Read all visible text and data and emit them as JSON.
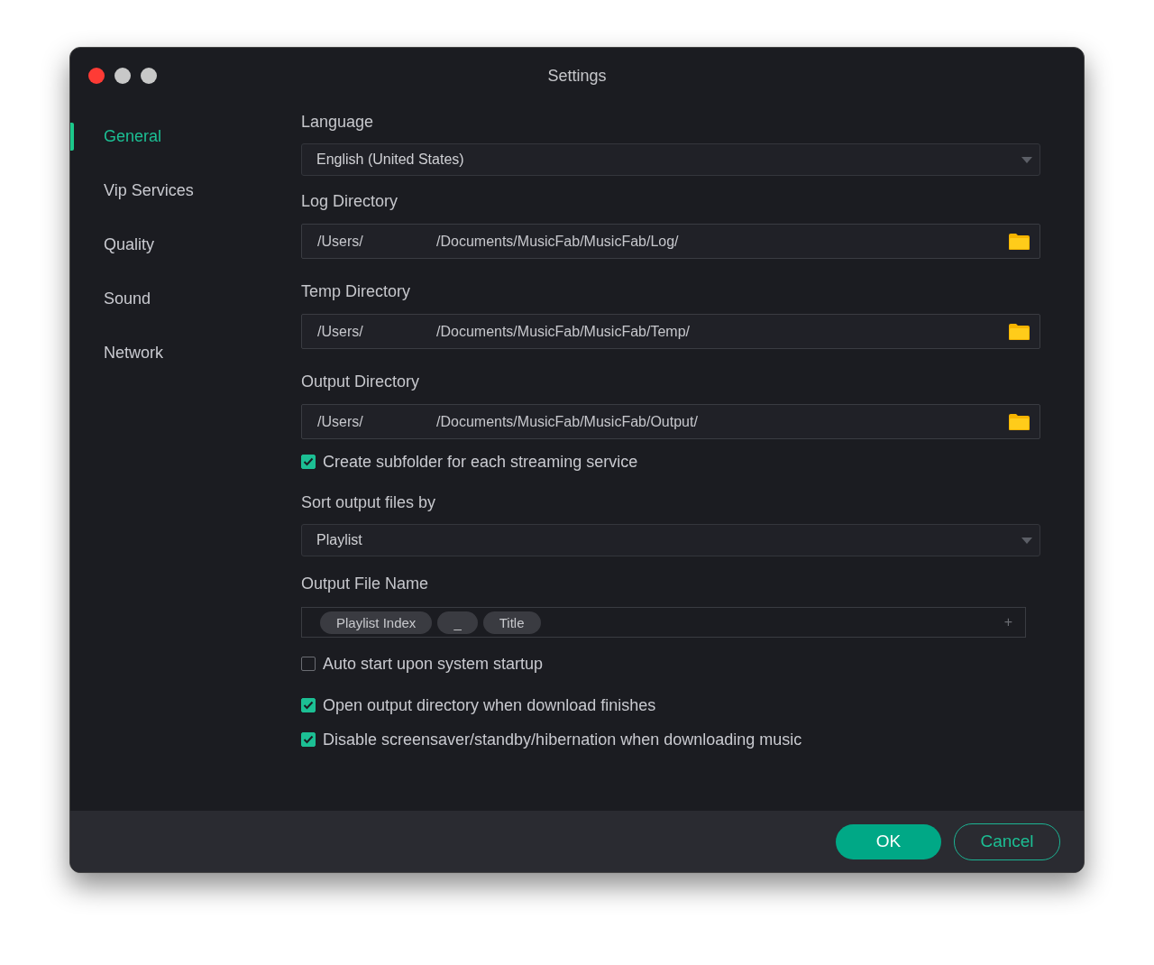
{
  "window": {
    "title": "Settings"
  },
  "sidebar": {
    "items": [
      {
        "label": "General",
        "selected": true
      },
      {
        "label": "Vip Services",
        "selected": false
      },
      {
        "label": "Quality",
        "selected": false
      },
      {
        "label": "Sound",
        "selected": false
      },
      {
        "label": "Network",
        "selected": false
      }
    ]
  },
  "settings": [
    {
      "kind": "select",
      "label": "Language",
      "value": "English (United States)"
    },
    {
      "kind": "directory",
      "label": "Log Directory",
      "path_start": "/Users/",
      "path_end": "/Documents/MusicFab/MusicFab/Log/"
    },
    {
      "kind": "directory",
      "label": "Temp Directory",
      "path_start": "/Users/",
      "path_end": "/Documents/MusicFab/MusicFab/Temp/"
    },
    {
      "kind": "directory",
      "label": "Output Directory",
      "path_start": "/Users/",
      "path_end": "/Documents/MusicFab/MusicFab/Output/"
    },
    {
      "kind": "checkbox",
      "label": "Create subfolder for each streaming service",
      "checked": true
    },
    {
      "kind": "select",
      "label": "Sort output files by",
      "value": "Playlist"
    },
    {
      "kind": "tokens",
      "label": "Output File Name",
      "tokens": [
        "Playlist Index",
        "_",
        "Title"
      ],
      "add": "+"
    },
    {
      "kind": "checkbox",
      "label": "Auto start upon system startup",
      "checked": false
    },
    {
      "kind": "checkbox",
      "label": "Open output directory when download finishes",
      "checked": true
    },
    {
      "kind": "checkbox",
      "label": "Disable screensaver/standby/hibernation when downloading music",
      "checked": true
    }
  ],
  "buttons": [
    {
      "label": "OK",
      "kind": "primary"
    },
    {
      "label": "Cancel",
      "kind": "secondary"
    }
  ]
}
